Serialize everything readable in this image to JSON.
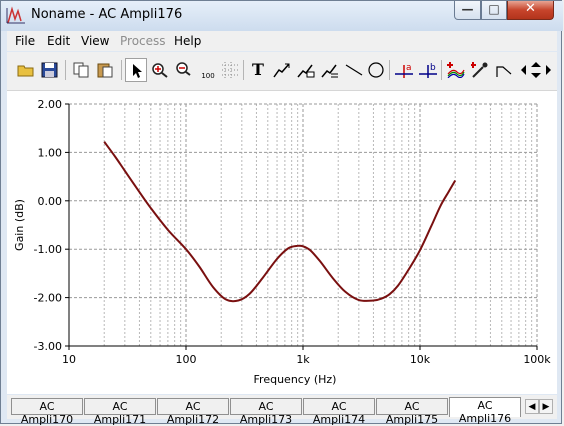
{
  "window": {
    "title": "Noname - AC Ampli176",
    "controls": {
      "minimize": "—",
      "maximize": "□",
      "close": "✕"
    }
  },
  "menu": {
    "items": [
      {
        "label": "File",
        "enabled": true
      },
      {
        "label": "Edit",
        "enabled": true
      },
      {
        "label": "View",
        "enabled": true
      },
      {
        "label": "Process",
        "enabled": false
      },
      {
        "label": "Help",
        "enabled": true
      }
    ]
  },
  "toolbar": {
    "tools": [
      "open-icon",
      "save-icon",
      "copy-icon",
      "paste-icon",
      "pointer-icon",
      "zoom-in-icon",
      "zoom-out-icon",
      "zoom-100-icon",
      "grid-icon",
      "text-icon",
      "arrow-annotation-icon",
      "comment-icon",
      "label-icon",
      "line-icon",
      "circle-icon",
      "cursor-a-icon",
      "cursor-b-icon",
      "add-curve-icon",
      "pick-curve-icon",
      "pen-icon",
      "left-arrow-icon",
      "move-icon",
      "right-arrow-icon"
    ],
    "zoom_100_label": "100",
    "cursor_a_label": "a",
    "cursor_b_label": "b",
    "text_tool_label": "T"
  },
  "chart_data": {
    "type": "line",
    "title": "",
    "xlabel": "Frequency (Hz)",
    "ylabel": "Gain (dB)",
    "x_scale": "log",
    "xlim": [
      10,
      100000
    ],
    "ylim": [
      -3,
      2
    ],
    "x_ticks": [
      {
        "value": 10,
        "label": "10"
      },
      {
        "value": 100,
        "label": "100"
      },
      {
        "value": 1000,
        "label": "1k"
      },
      {
        "value": 10000,
        "label": "10k"
      },
      {
        "value": 100000,
        "label": "100k"
      }
    ],
    "y_ticks": [
      {
        "value": 2,
        "label": "2.00"
      },
      {
        "value": 1,
        "label": "1.00"
      },
      {
        "value": 0,
        "label": "0.00"
      },
      {
        "value": -1,
        "label": "-1.00"
      },
      {
        "value": -2,
        "label": "-2.00"
      },
      {
        "value": -3,
        "label": "-3.00"
      }
    ],
    "grid": true,
    "series": [
      {
        "color": "#7a1010",
        "x": [
          20,
          25,
          30,
          40,
          50,
          70,
          100,
          130,
          170,
          220,
          280,
          350,
          450,
          600,
          750,
          900,
          1000,
          1150,
          1400,
          1800,
          2300,
          3000,
          4000,
          4700,
          5500,
          6500,
          8000,
          10000,
          12500,
          15000,
          17500,
          20000
        ],
        "y": [
          1.22,
          0.9,
          0.62,
          0.18,
          -0.15,
          -0.6,
          -1.0,
          -1.36,
          -1.78,
          -2.04,
          -2.06,
          -1.92,
          -1.6,
          -1.2,
          -0.98,
          -0.93,
          -0.94,
          -1.02,
          -1.25,
          -1.6,
          -1.88,
          -2.05,
          -2.06,
          -2.02,
          -1.93,
          -1.75,
          -1.42,
          -1.02,
          -0.52,
          -0.1,
          0.18,
          0.42
        ]
      }
    ]
  },
  "tabs": {
    "items": [
      "AC Ampli170",
      "AC Ampli171",
      "AC Ampli172",
      "AC Ampli173",
      "AC Ampli174",
      "AC Ampli175",
      "AC Ampli176"
    ],
    "active_index": 6
  }
}
